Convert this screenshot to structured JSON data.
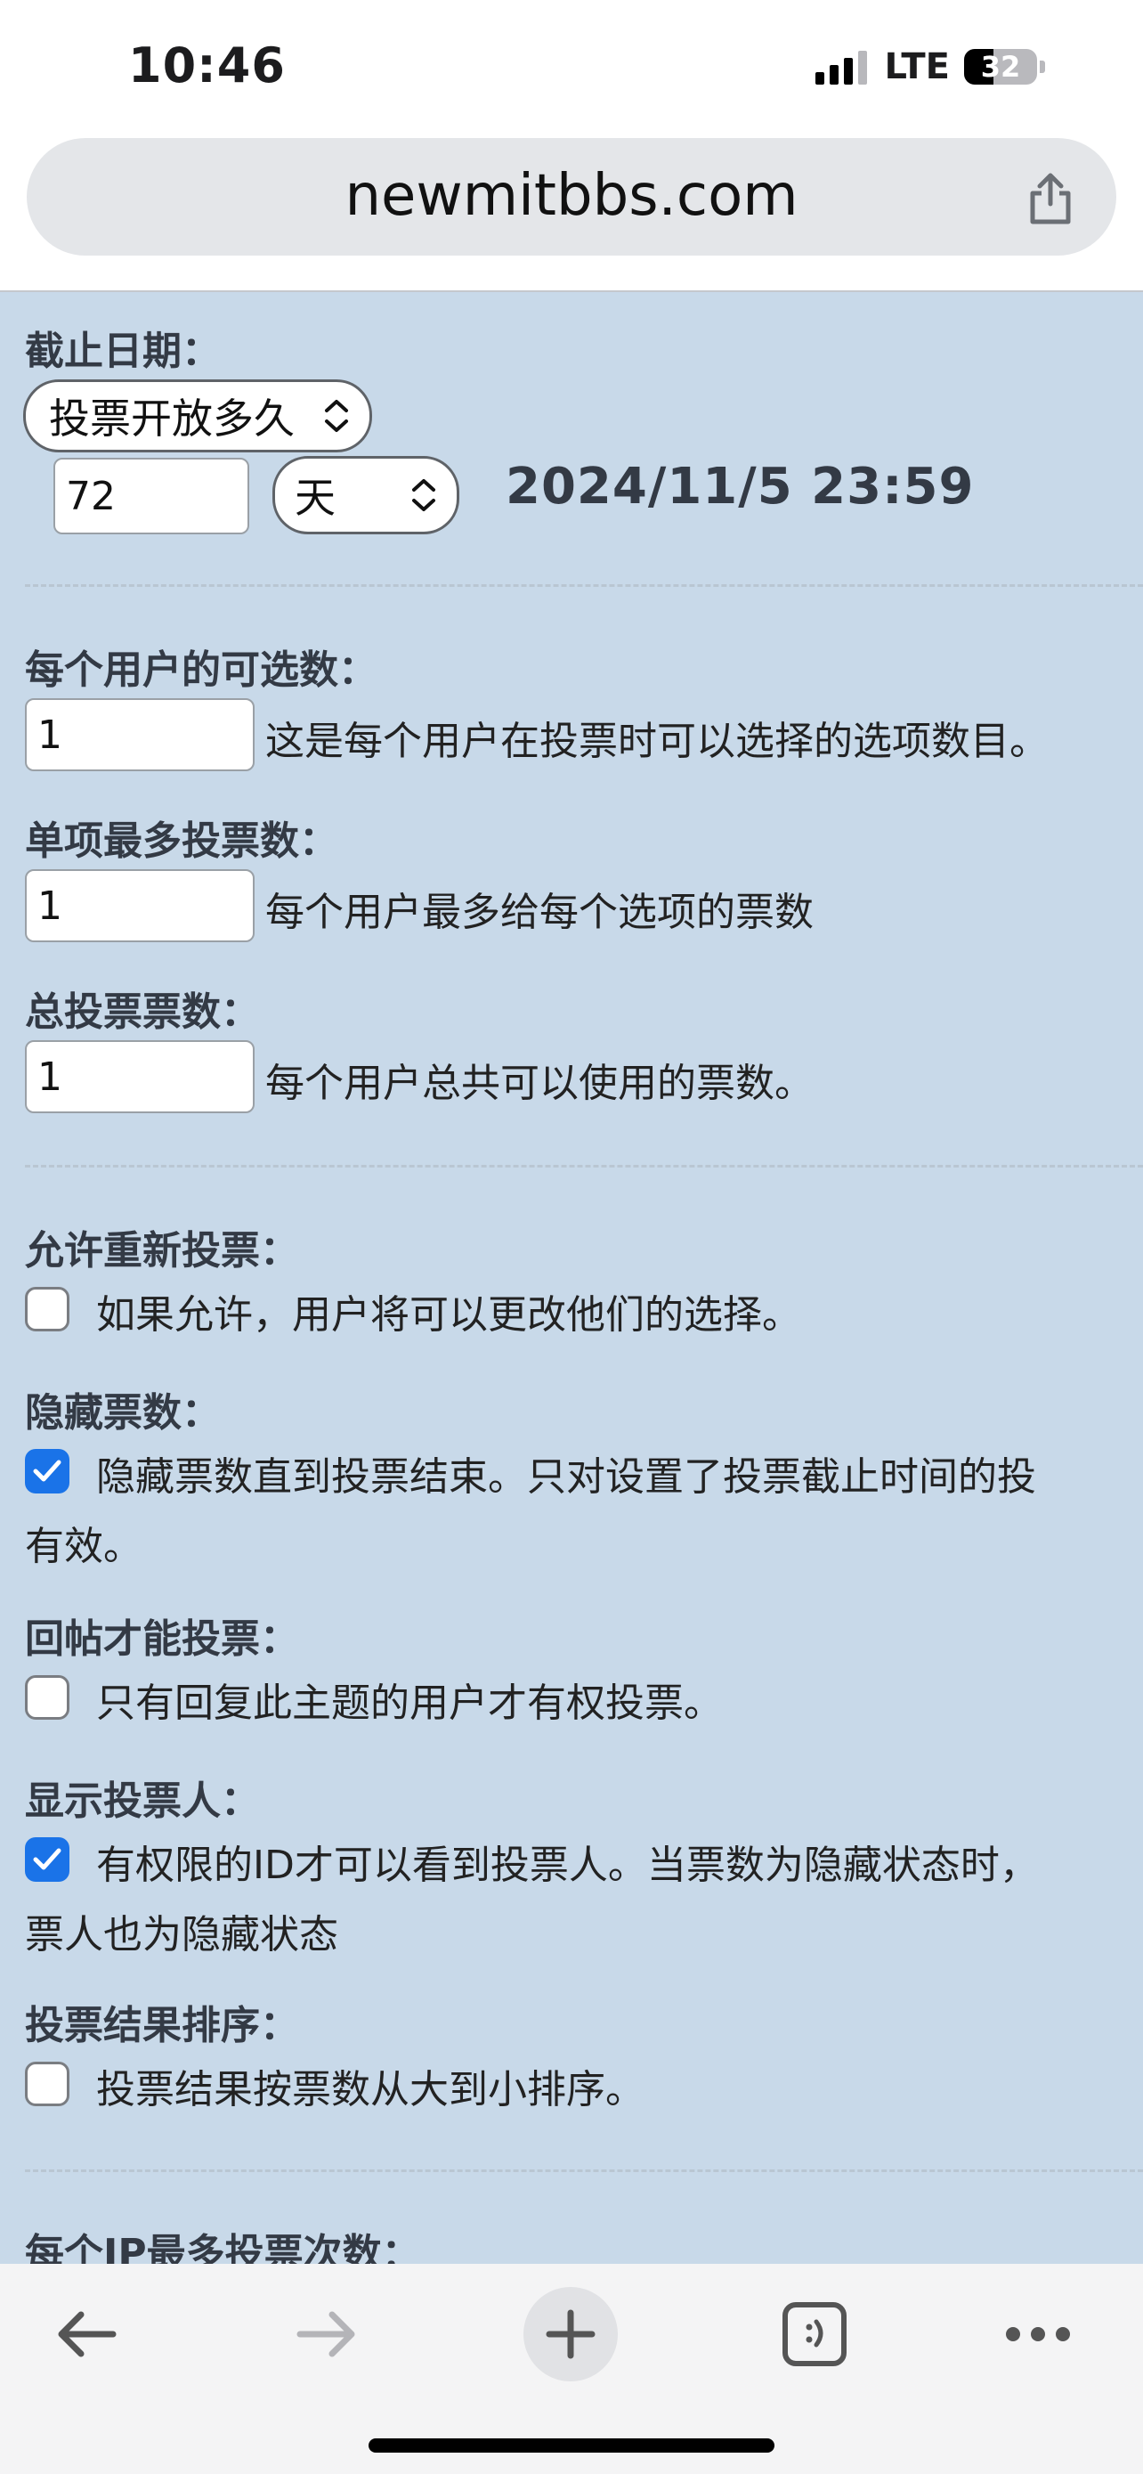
{
  "status_bar": {
    "time": "10:46",
    "network": "LTE",
    "battery": "32"
  },
  "browser": {
    "url": "newmitbbs.com"
  },
  "form": {
    "deadline": {
      "label": "截止日期：",
      "mode_select": "投票开放多久",
      "duration_value": "72",
      "unit_select": "天",
      "computed_date": "2024/11/5 23:59"
    },
    "choices_per_user": {
      "label": "每个用户的可选数：",
      "value": "1",
      "desc": "这是每个用户在投票时可以选择的选项数目。"
    },
    "max_votes_per_option": {
      "label": "单项最多投票数：",
      "value": "1",
      "desc": "每个用户最多给每个选项的票数"
    },
    "total_votes": {
      "label": "总投票票数：",
      "value": "1",
      "desc": "每个用户总共可以使用的票数。"
    },
    "allow_revote": {
      "label": "允许重新投票：",
      "checked": false,
      "desc": "如果允许，用户将可以更改他们的选择。"
    },
    "hide_votes": {
      "label": "隐藏票数：",
      "checked": true,
      "desc": "隐藏票数直到投票结束。只对设置了投票截止时间的投",
      "desc_cont": "有效。"
    },
    "reply_to_vote": {
      "label": "回帖才能投票：",
      "checked": false,
      "desc": "只有回复此主题的用户才有权投票。"
    },
    "show_voters": {
      "label": "显示投票人：",
      "checked": true,
      "desc": "有权限的ID才可以看到投票人。当票数为隐藏状态时，",
      "desc_cont": "票人也为隐藏状态"
    },
    "sort_results": {
      "label": "投票结果排序：",
      "checked": false,
      "desc": "投票结果按票数从大到小排序。"
    },
    "max_votes_per_ip": {
      "label": "每个IP最多投票次数："
    }
  },
  "colors": {
    "content_bg": "#c8d9e9",
    "label": "#333a45",
    "checkbox_on": "#1a73e8"
  }
}
